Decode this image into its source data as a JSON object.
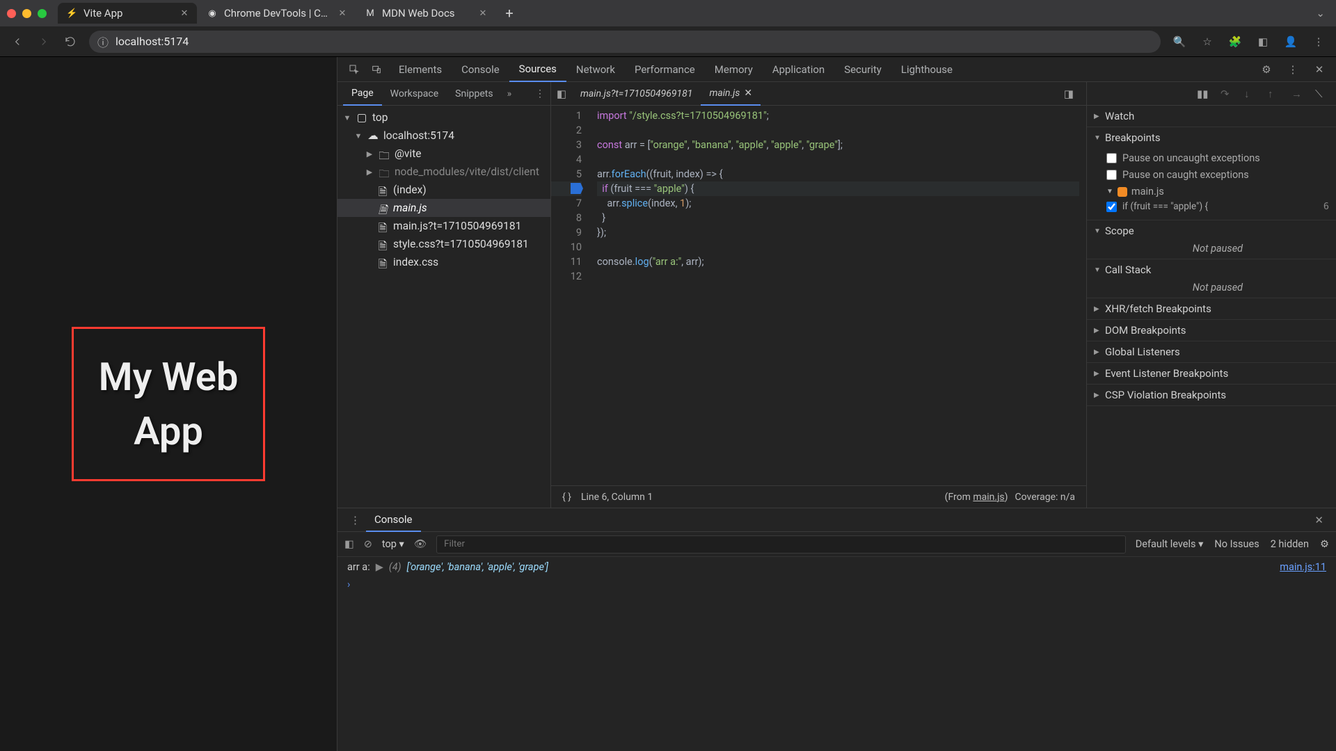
{
  "browser": {
    "tabs": [
      {
        "title": "Vite App",
        "icon": "⚡",
        "active": true
      },
      {
        "title": "Chrome DevTools | Chrome",
        "icon": "◉",
        "active": false
      },
      {
        "title": "MDN Web Docs",
        "icon": "M",
        "active": false
      }
    ],
    "url": "localhost:5174"
  },
  "page": {
    "heading_line1": "My Web",
    "heading_line2": "App"
  },
  "devtools": {
    "tabs": [
      "Elements",
      "Console",
      "Sources",
      "Network",
      "Performance",
      "Memory",
      "Application",
      "Security",
      "Lighthouse"
    ],
    "active_tab": "Sources",
    "sources_subtabs": [
      "Page",
      "Workspace",
      "Snippets"
    ],
    "active_subtab": "Page",
    "file_tree": {
      "top": "top",
      "host": "localhost:5174",
      "folder1": "@vite",
      "folder2": "node_modules/vite/dist/client",
      "files": [
        "(index)",
        "main.js",
        "main.js?t=1710504969181",
        "style.css?t=1710504969181",
        "index.css"
      ],
      "selected": "main.js"
    },
    "editor_tabs": [
      {
        "label": "main.js?t=1710504969181",
        "active": false
      },
      {
        "label": "main.js",
        "active": true
      }
    ],
    "code_lines": [
      {
        "n": 1,
        "tokens": [
          [
            "kw",
            "import"
          ],
          [
            "var",
            " "
          ],
          [
            "str",
            "\"/style.css?t=1710504969181\""
          ],
          [
            "var",
            ";"
          ]
        ]
      },
      {
        "n": 2,
        "tokens": [
          [
            "var",
            ""
          ]
        ]
      },
      {
        "n": 3,
        "tokens": [
          [
            "kw",
            "const"
          ],
          [
            "var",
            " arr = ["
          ],
          [
            "str",
            "\"orange\""
          ],
          [
            "var",
            ", "
          ],
          [
            "str",
            "\"banana\""
          ],
          [
            "var",
            ", "
          ],
          [
            "str",
            "\"apple\""
          ],
          [
            "var",
            ", "
          ],
          [
            "str",
            "\"apple\""
          ],
          [
            "var",
            ", "
          ],
          [
            "str",
            "\"grape\""
          ],
          [
            "var",
            "];"
          ]
        ]
      },
      {
        "n": 4,
        "tokens": [
          [
            "var",
            ""
          ]
        ]
      },
      {
        "n": 5,
        "tokens": [
          [
            "var",
            "arr."
          ],
          [
            "fn",
            "forEach"
          ],
          [
            "var",
            "((fruit, index) => {"
          ]
        ]
      },
      {
        "n": 6,
        "bp": true,
        "cur": true,
        "tokens": [
          [
            "var",
            "  "
          ],
          [
            "kw",
            "if"
          ],
          [
            "var",
            " (fruit === "
          ],
          [
            "str",
            "\"apple\""
          ],
          [
            "var",
            ") {"
          ]
        ]
      },
      {
        "n": 7,
        "tokens": [
          [
            "var",
            "    arr."
          ],
          [
            "fn",
            "splice"
          ],
          [
            "var",
            "(index, "
          ],
          [
            "num",
            "1"
          ],
          [
            "var",
            ");"
          ]
        ]
      },
      {
        "n": 8,
        "tokens": [
          [
            "var",
            "  }"
          ]
        ]
      },
      {
        "n": 9,
        "tokens": [
          [
            "var",
            "});"
          ]
        ]
      },
      {
        "n": 10,
        "tokens": [
          [
            "var",
            ""
          ]
        ]
      },
      {
        "n": 11,
        "tokens": [
          [
            "var",
            "console."
          ],
          [
            "fn",
            "log"
          ],
          [
            "var",
            "("
          ],
          [
            "str",
            "\"arr a:\""
          ],
          [
            "var",
            ", arr);"
          ]
        ]
      },
      {
        "n": 12,
        "tokens": [
          [
            "var",
            ""
          ]
        ]
      }
    ],
    "cursor_status": "Line 6, Column 1",
    "from_label": "(From ",
    "from_file": "main.js",
    "from_close": ")",
    "coverage": "Coverage: n/a",
    "debugger": {
      "sections": {
        "watch": "Watch",
        "breakpoints": "Breakpoints",
        "scope": "Scope",
        "callstack": "Call Stack",
        "xhr": "XHR/fetch Breakpoints",
        "dom": "DOM Breakpoints",
        "global": "Global Listeners",
        "event": "Event Listener Breakpoints",
        "csp": "CSP Violation Breakpoints"
      },
      "pause_uncaught": "Pause on uncaught exceptions",
      "pause_caught": "Pause on caught exceptions",
      "bp_file": "main.js",
      "bp_code": "if (fruit === \"apple\") {",
      "bp_line": "6",
      "not_paused": "Not paused"
    }
  },
  "console": {
    "drawer_tab": "Console",
    "context": "top",
    "filter_ph": "Filter",
    "levels": "Default levels",
    "issues": "No Issues",
    "hidden": "2 hidden",
    "log_label": "arr a:",
    "log_count": "(4)",
    "log_array": "['orange', 'banana', 'apple', 'grape']",
    "log_src": "main.js:11"
  }
}
